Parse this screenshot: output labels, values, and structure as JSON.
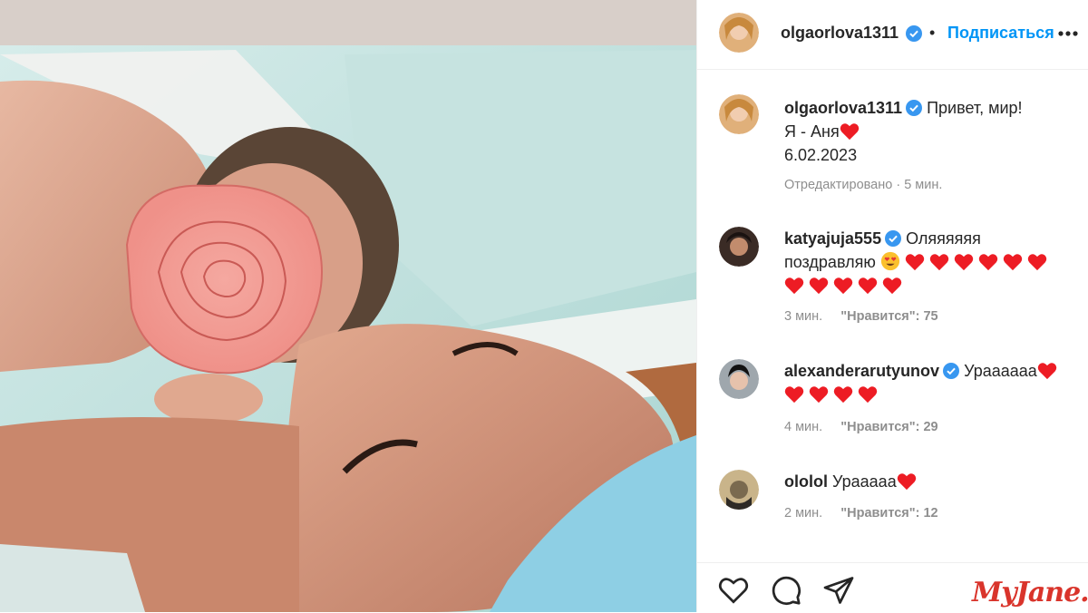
{
  "post": {
    "author": "olgaorlova1311",
    "separator": "•",
    "follow_label": "Подписаться",
    "more_icon": "more-icon",
    "caption_lines": [
      "Привет, мир!",
      "Я - Аня",
      "6.02.2023"
    ],
    "edited_label": "Отредактировано · 5 мин.",
    "photo_description_icon": "photo"
  },
  "comments": [
    {
      "user": "katyajuja555",
      "verified": true,
      "text_line1": "Оляяяяяя",
      "text_line2": "поздравляю",
      "time": "3 мин.",
      "likes_label": "\"Нравится\": 75"
    },
    {
      "user": "alexanderarutyunov",
      "verified": true,
      "text_line1": "Ураааааа",
      "time": "4 мин.",
      "likes_label": "\"Нравится\": 29"
    },
    {
      "user": "ololol",
      "verified": false,
      "text_line1": "Урааааа",
      "time": "2 мин.",
      "likes_label": "\"Нравится\": 12"
    }
  ],
  "watermark": "MyJane.ru",
  "colors": {
    "accent": "#0095f6",
    "verified": "#3897f0",
    "heart": "#ed1c24",
    "muted": "#8e8e8e"
  }
}
